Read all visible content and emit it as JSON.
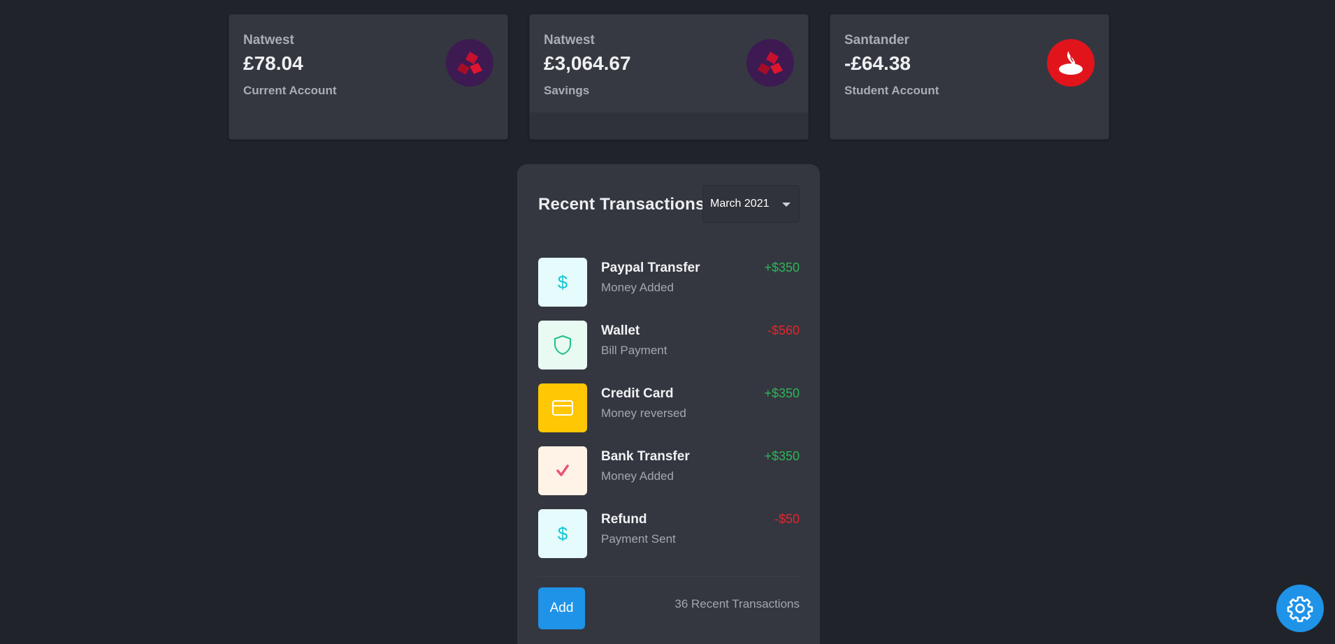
{
  "accounts": [
    {
      "bank": "Natwest",
      "amount": "£78.04",
      "type": "Current Account",
      "logo_icon": "natwest-logo-icon",
      "logo_color": "#3d1a52"
    },
    {
      "bank": "Natwest",
      "amount": "£3,064.67",
      "type": "Savings",
      "logo_icon": "natwest-logo-icon",
      "logo_color": "#3d1a52"
    },
    {
      "bank": "Santander",
      "amount": "-£64.38",
      "type": "Student Account",
      "logo_icon": "santander-logo-icon",
      "logo_color": "#e2141b"
    }
  ],
  "transactions_panel": {
    "title": "Recent Transactions",
    "month_selected": "March 2021",
    "items": [
      {
        "name": "Paypal Transfer",
        "subtitle": "Money Added",
        "amount": "+$350",
        "direction": "positive",
        "icon": "dollar-icon",
        "icon_bg": "#e6fbfb",
        "icon_color": "#14c7d4"
      },
      {
        "name": "Wallet",
        "subtitle": "Bill Payment",
        "amount": "-$560",
        "direction": "negative",
        "icon": "shield-icon",
        "icon_bg": "#e8faf2",
        "icon_color": "#1fc08a"
      },
      {
        "name": "Credit Card",
        "subtitle": "Money reversed",
        "amount": "+$350",
        "direction": "positive",
        "icon": "credit-card-icon",
        "icon_bg": "#ffc704",
        "icon_color": "#ffffff"
      },
      {
        "name": "Bank Transfer",
        "subtitle": "Money Added",
        "amount": "+$350",
        "direction": "positive",
        "icon": "check-icon",
        "icon_bg": "#fff2e6",
        "icon_color": "#e85472"
      },
      {
        "name": "Refund",
        "subtitle": "Payment Sent",
        "amount": "-$50",
        "direction": "negative",
        "icon": "dollar-icon",
        "icon_bg": "#e6fbfb",
        "icon_color": "#14c7d4"
      }
    ],
    "add_label": "Add",
    "recent_count_label": "36 Recent Transactions"
  },
  "colors": {
    "background": "#20232a",
    "card": "#343740",
    "accent": "#1f93e8",
    "positive": "#2fb457",
    "negative": "#e3252d"
  },
  "settings_icon": "gear-icon"
}
